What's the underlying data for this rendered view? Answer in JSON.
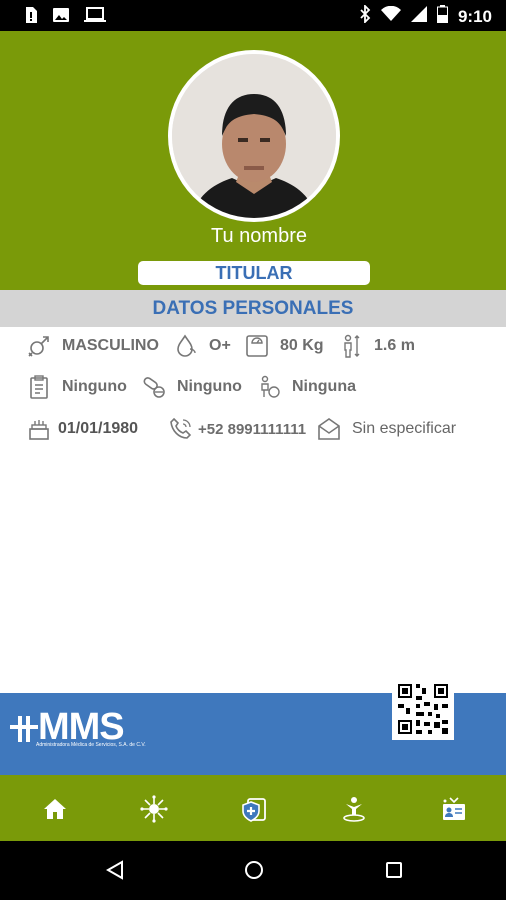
{
  "status_bar": {
    "time": "9:10",
    "icons": [
      "sim-alert-icon",
      "image-icon",
      "laptop-icon",
      "bluetooth-icon",
      "wifi-icon",
      "signal-icon",
      "battery-icon"
    ]
  },
  "profile": {
    "name": "Tu nombre",
    "badge": "TITULAR"
  },
  "section_title": "DATOS PERSONALES",
  "rows": [
    {
      "items": [
        {
          "icon": "gender-icon",
          "value": "MASCULINO"
        },
        {
          "icon": "blood-drop-icon",
          "value": "O+"
        },
        {
          "icon": "scale-icon",
          "value": "80 Kg"
        },
        {
          "icon": "height-icon",
          "value": "1.6 m"
        }
      ]
    },
    {
      "items": [
        {
          "icon": "clipboard-icon",
          "value": "Ninguno"
        },
        {
          "icon": "pills-icon",
          "value": "Ninguno"
        },
        {
          "icon": "disability-icon",
          "value": "Ninguna"
        }
      ]
    },
    {
      "items": [
        {
          "icon": "birthday-cake-icon",
          "value": "01/01/1980"
        },
        {
          "icon": "phone-icon",
          "value": "+52 8991111111"
        },
        {
          "icon": "email-icon",
          "value": "Sin especificar"
        }
      ]
    }
  ],
  "footer": {
    "logo_text": "MMS",
    "logo_subtext": "Administradora Médica de Servicios, S.A. de C.V."
  },
  "bottom_nav": [
    "home-icon",
    "network-icon",
    "medical-shield-icon",
    "person-location-icon",
    "id-card-icon"
  ],
  "colors": {
    "primary_green": "#7a9a09",
    "accent_blue": "#3a6fb5",
    "footer_blue": "#3f78bd",
    "section_gray": "#d4d4d4",
    "icon_gray": "#6d6d6d"
  }
}
